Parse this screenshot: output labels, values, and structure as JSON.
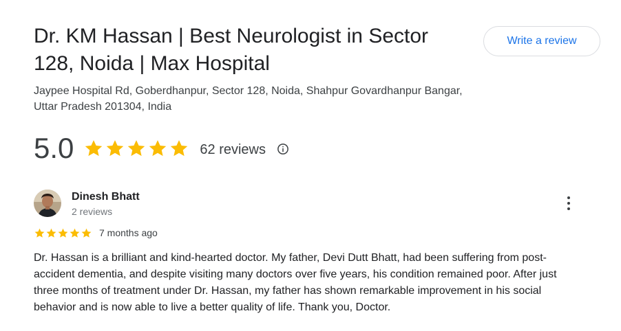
{
  "place": {
    "title": "Dr. KM Hassan | Best Neurologist in Sector 128, Noida | Max Hospital",
    "address": "Jaypee Hospital Rd, Goberdhanpur, Sector 128, Noida, Shahpur Govardhanpur Bangar, Uttar Pradesh 201304, India",
    "write_review_label": "Write a review"
  },
  "rating": {
    "score": "5.0",
    "stars": 5,
    "reviews_count_label": "62 reviews",
    "info_icon": "info-icon"
  },
  "review": {
    "reviewer_name": "Dinesh Bhatt",
    "reviewer_meta": "2 reviews",
    "stars": 5,
    "date": "7 months ago",
    "text": "Dr. Hassan is a brilliant and kind-hearted doctor. My father, Devi Dutt Bhatt, had been suffering from post-accident dementia, and despite visiting many doctors over five years, his condition remained poor. After just three months of treatment under Dr. Hassan, my father has shown remarkable improvement in his social behavior and is now able to live a better quality of life. Thank you, Doctor.",
    "more_icon": "more-vert-icon"
  },
  "colors": {
    "star": "#fbbc04",
    "link": "#1a73e8",
    "text": "#202124",
    "secondary": "#70757a"
  }
}
